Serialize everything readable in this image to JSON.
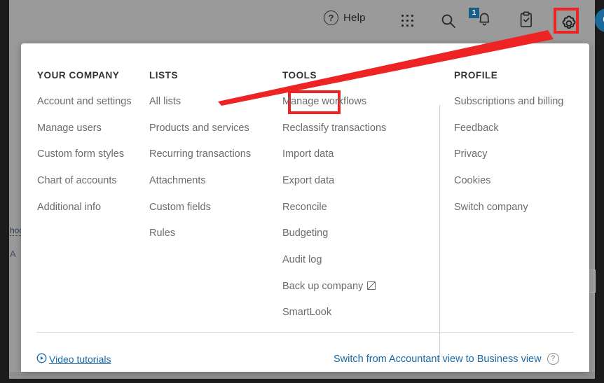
{
  "topbar": {
    "help_label": "Help",
    "help_icon": "question-circle-icon",
    "grid_icon": "apps-grid-icon",
    "search_icon": "search-icon",
    "bell_icon": "notification-bell-icon",
    "notification_count": "1",
    "clipboard_icon": "clipboard-check-icon",
    "gear_icon": "gear-icon",
    "avatar_initial": "C"
  },
  "background": {
    "partial_text": "hoo",
    "partial_text_2": "A",
    "chevron_icon": "chevron-up-icon"
  },
  "menu": {
    "columns": [
      {
        "heading": "YOUR COMPANY",
        "items": [
          {
            "label": "Account and settings"
          },
          {
            "label": "Manage users"
          },
          {
            "label": "Custom form styles"
          },
          {
            "label": "Chart of accounts"
          },
          {
            "label": "Additional info"
          }
        ]
      },
      {
        "heading": "LISTS",
        "items": [
          {
            "label": "All lists"
          },
          {
            "label": "Products and services"
          },
          {
            "label": "Recurring transactions"
          },
          {
            "label": "Attachments"
          },
          {
            "label": "Custom fields"
          },
          {
            "label": "Rules"
          }
        ]
      },
      {
        "heading": "TOOLS",
        "items": [
          {
            "label": "Manage workflows"
          },
          {
            "label": "Reclassify transactions"
          },
          {
            "label": "Import data"
          },
          {
            "label": "Export data"
          },
          {
            "label": "Reconcile"
          },
          {
            "label": "Budgeting"
          },
          {
            "label": "Audit log"
          },
          {
            "label": "Back up company",
            "external": true
          },
          {
            "label": "SmartLook"
          }
        ]
      },
      {
        "heading": "PROFILE",
        "items": [
          {
            "label": "Subscriptions and billing"
          },
          {
            "label": "Feedback"
          },
          {
            "label": "Privacy"
          },
          {
            "label": "Cookies"
          },
          {
            "label": "Switch company"
          }
        ]
      }
    ]
  },
  "footer": {
    "video_label": "Video tutorials",
    "video_icon": "play-circle-icon",
    "switch_label": "Switch from Accountant view to Business view",
    "help_icon": "question-circle-icon"
  },
  "annotations": {
    "highlight_color": "#ee2424",
    "arrow_from": "gear-icon",
    "arrow_to": "All lists"
  },
  "colors": {
    "accent_link": "#1668a6",
    "highlight_red": "#ee2424",
    "badge_blue": "#1a5e87",
    "avatar_blue": "#1a6a9c",
    "dim_overlay": "#9a9a9a"
  }
}
